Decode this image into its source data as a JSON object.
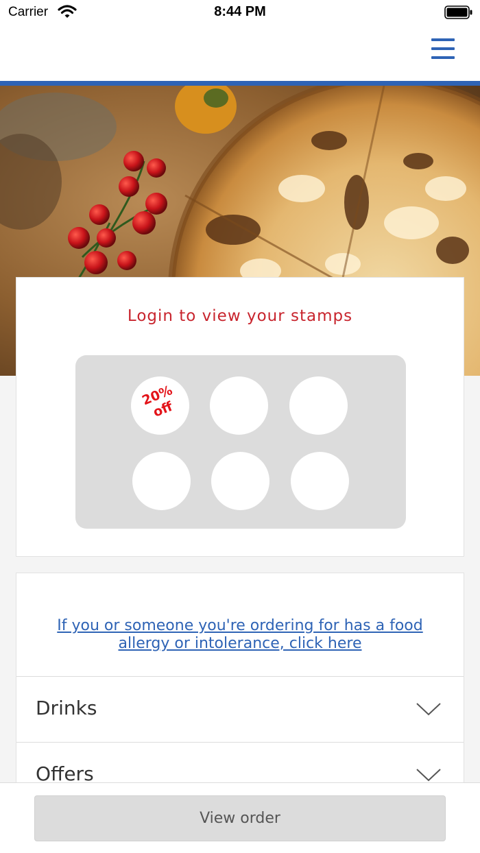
{
  "status_bar": {
    "carrier": "Carrier",
    "time": "8:44 PM"
  },
  "header": {
    "menu_icon": "hamburger-menu-icon",
    "accent_color": "#2e63b5"
  },
  "hero": {
    "image": "pizza-photo"
  },
  "stamp_card": {
    "title": "Login to view your stamps",
    "title_color": "#c8242d",
    "total_stamps": 6,
    "stamps": [
      {
        "reward_line1": "20%",
        "reward_line2": "off"
      },
      {
        "reward_line1": "",
        "reward_line2": ""
      },
      {
        "reward_line1": "",
        "reward_line2": ""
      },
      {
        "reward_line1": "",
        "reward_line2": ""
      },
      {
        "reward_line1": "",
        "reward_line2": ""
      },
      {
        "reward_line1": "",
        "reward_line2": ""
      }
    ]
  },
  "menu": {
    "allergy_link": "If you or someone you're ordering for has a food allergy or intolerance, click here",
    "categories": [
      {
        "label": "Drinks",
        "icon": "chevron-down-icon"
      },
      {
        "label": "Offers",
        "icon": "chevron-down-icon"
      }
    ]
  },
  "footer": {
    "view_order_label": "View order"
  }
}
